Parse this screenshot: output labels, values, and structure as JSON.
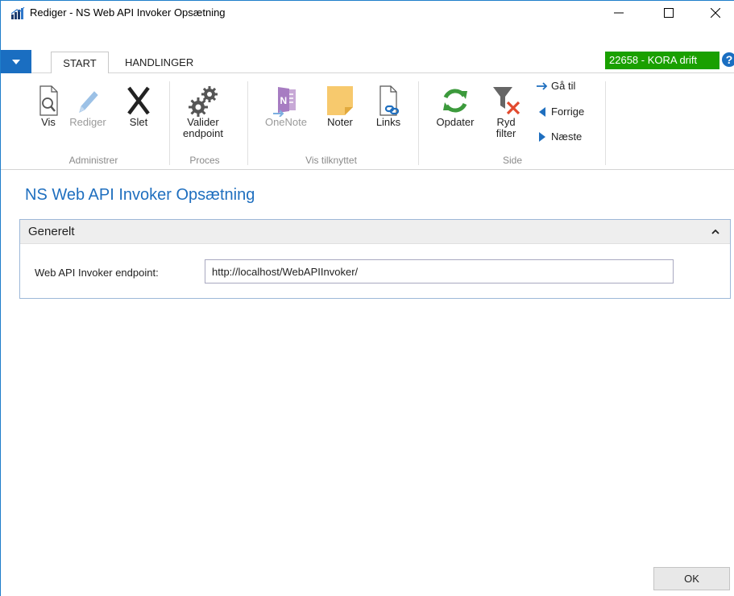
{
  "window": {
    "title": "Rediger - NS Web API Invoker Opsætning"
  },
  "tabs": {
    "start": "START",
    "handlinger": "HANDLINGER"
  },
  "company": "22658 - KORA drift",
  "ribbon": {
    "vis": "Vis",
    "rediger": "Rediger",
    "slet": "Slet",
    "administrer": "Administrer",
    "valider_1": "Valider",
    "valider_2": "endpoint",
    "proces": "Proces",
    "onenote": "OneNote",
    "noter": "Noter",
    "links": "Links",
    "vis_tilknyttet": "Vis tilknyttet",
    "opdater": "Opdater",
    "ryd_1": "Ryd",
    "ryd_2": "filter",
    "gaa_til": "Gå til",
    "forrige": "Forrige",
    "naeste": "Næste",
    "side": "Side"
  },
  "page": {
    "title": "NS Web API Invoker Opsætning",
    "section": "Generelt",
    "field_label": "Web API Invoker endpoint:",
    "field_value": "http://localhost/WebAPIInvoker/"
  },
  "footer": {
    "ok": "OK"
  },
  "colors": {
    "accent": "#1f6fbf",
    "badge": "#1aa000",
    "file_button": "#1a6ec1"
  }
}
